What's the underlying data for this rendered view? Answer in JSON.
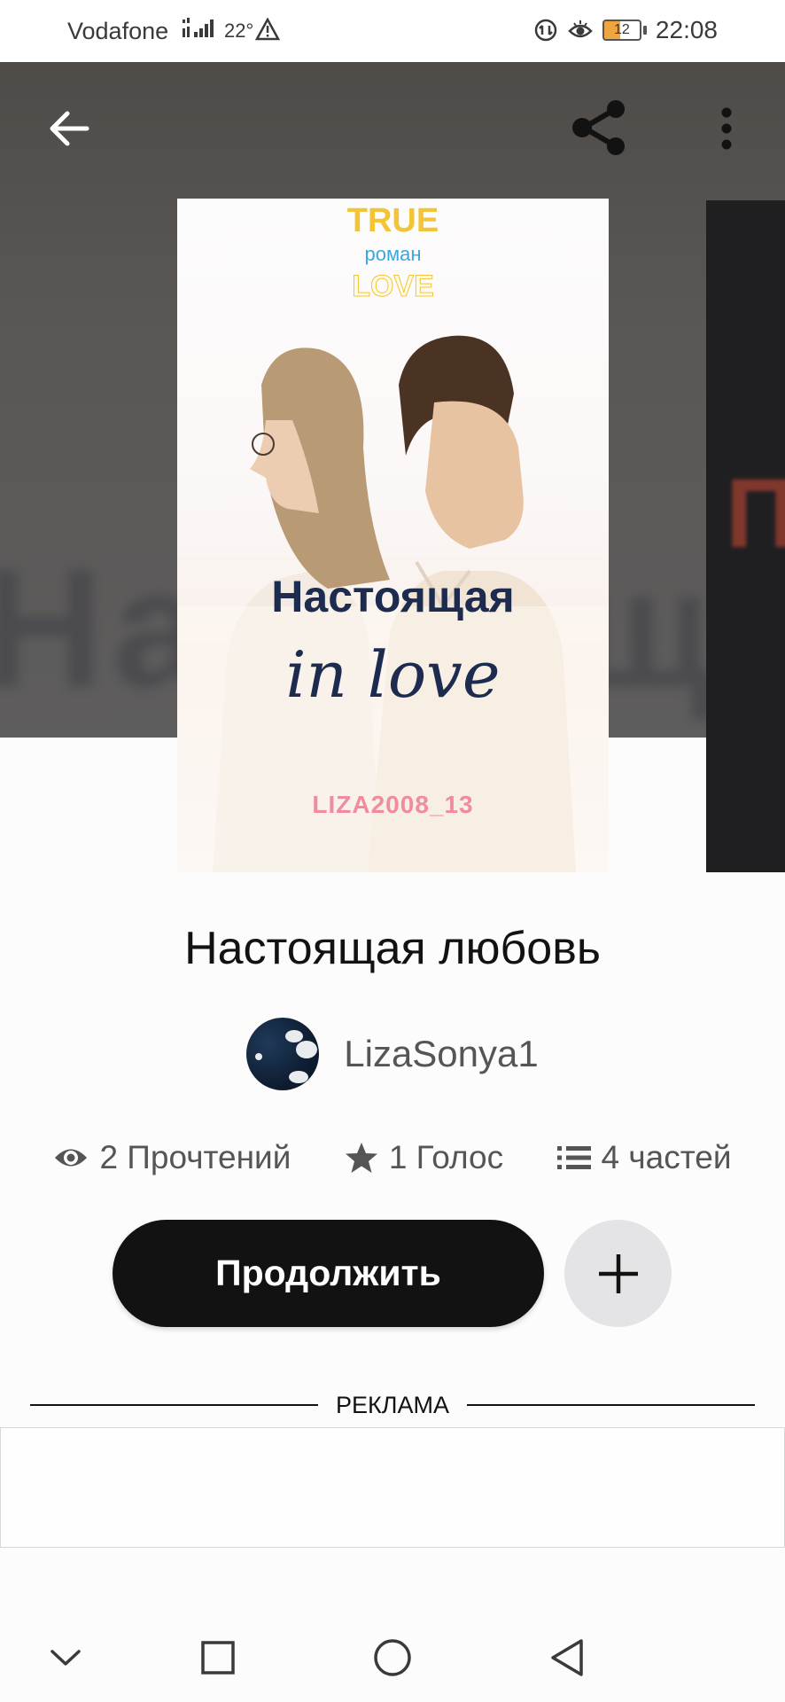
{
  "status_bar": {
    "carrier": "Vodafone",
    "temperature": "22°",
    "battery": "12",
    "time": "22:08"
  },
  "header": {
    "back_icon": "arrow-left-icon",
    "share_icon": "share-icon",
    "more_icon": "more-vertical-icon"
  },
  "cover": {
    "top_word": "TRUE",
    "genre": "роман",
    "bottom_word": "LOVE",
    "title": "Настоящая",
    "script": "in love",
    "author": "LIZA2008_13"
  },
  "book": {
    "title": "Настоящая любовь",
    "author": "LizaSonya1"
  },
  "stats": {
    "reads": "2 Прочтений",
    "votes": "1 Голос",
    "parts": "4 частей"
  },
  "actions": {
    "continue_label": "Продолжить",
    "add_icon": "plus-icon"
  },
  "ad": {
    "label": "РЕКЛАМА"
  },
  "nav_bar": {
    "icons": [
      "chevron-down-icon",
      "square-icon",
      "circle-icon",
      "triangle-back-icon"
    ]
  }
}
